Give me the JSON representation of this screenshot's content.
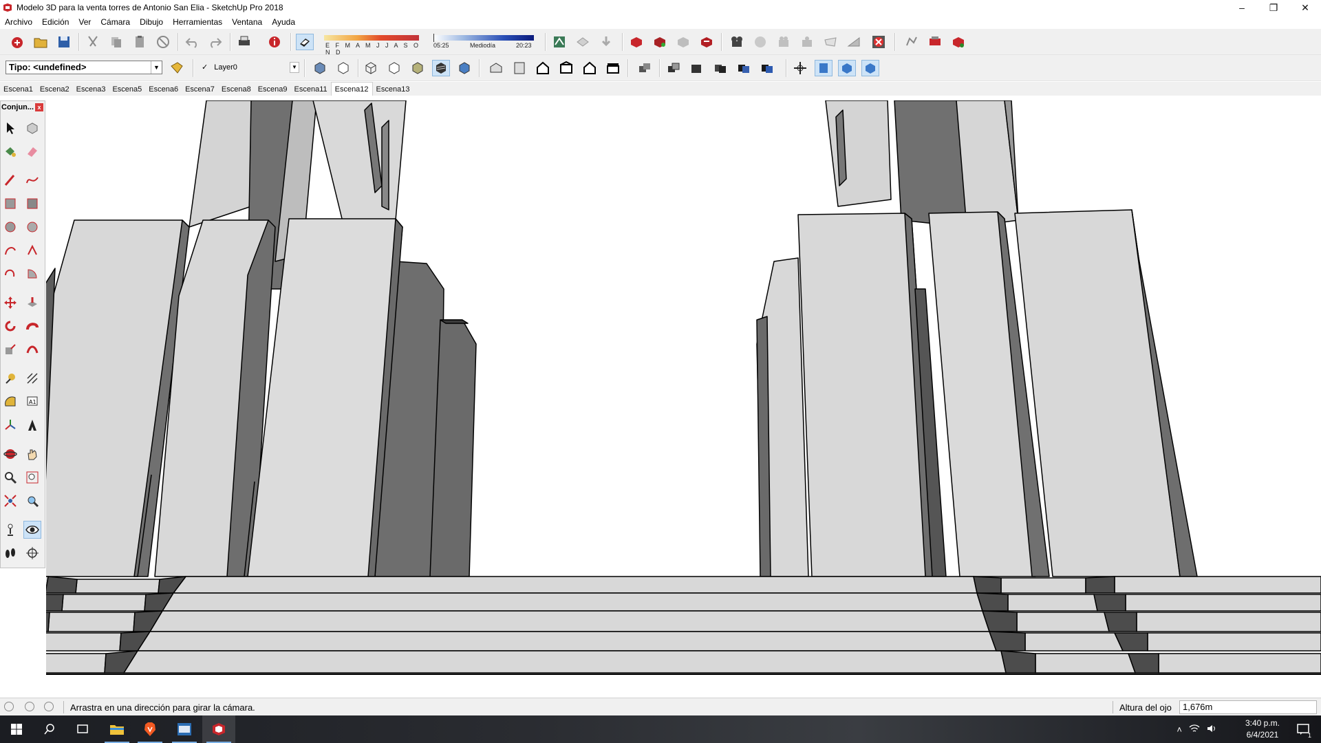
{
  "window": {
    "title": "Modelo 3D para la venta torres de Antonio San Elia - SketchUp Pro 2018",
    "minimize": "–",
    "restore": "❐",
    "close": "✕"
  },
  "menu": [
    "Archivo",
    "Edición",
    "Ver",
    "Cámara",
    "Dibujo",
    "Herramientas",
    "Ventana",
    "Ayuda"
  ],
  "shadow": {
    "months": "E F M A M J J A S O N D",
    "sunrise": "05:25",
    "midday": "Mediodía",
    "sunset": "20:23"
  },
  "tag_selector": {
    "value": "Tipo: <undefined>"
  },
  "layer_selector": {
    "check": "✓",
    "value": "Layer0"
  },
  "scenes": {
    "tabs": [
      "Escena1",
      "Escena2",
      "Escena3",
      "Escena5",
      "Escena6",
      "Escena7",
      "Escena8",
      "Escena9",
      "Escena11",
      "Escena12",
      "Escena13"
    ],
    "active": "Escena12"
  },
  "palette": {
    "title": "Conjun...",
    "close": "x"
  },
  "statusbar": {
    "message": "Arrastra en una dirección para girar la cámara.",
    "eye_height_label": "Altura del ojo",
    "eye_height_value": "1,676m"
  },
  "taskbar": {
    "time": "3:40 p.m.",
    "date": "6/4/2021",
    "notification_count": "1"
  },
  "colors": {
    "facade_light": "#d8d8d8",
    "facade_dark": "#6e6e6e",
    "edge": "#000000",
    "sky": "#ffffff"
  }
}
